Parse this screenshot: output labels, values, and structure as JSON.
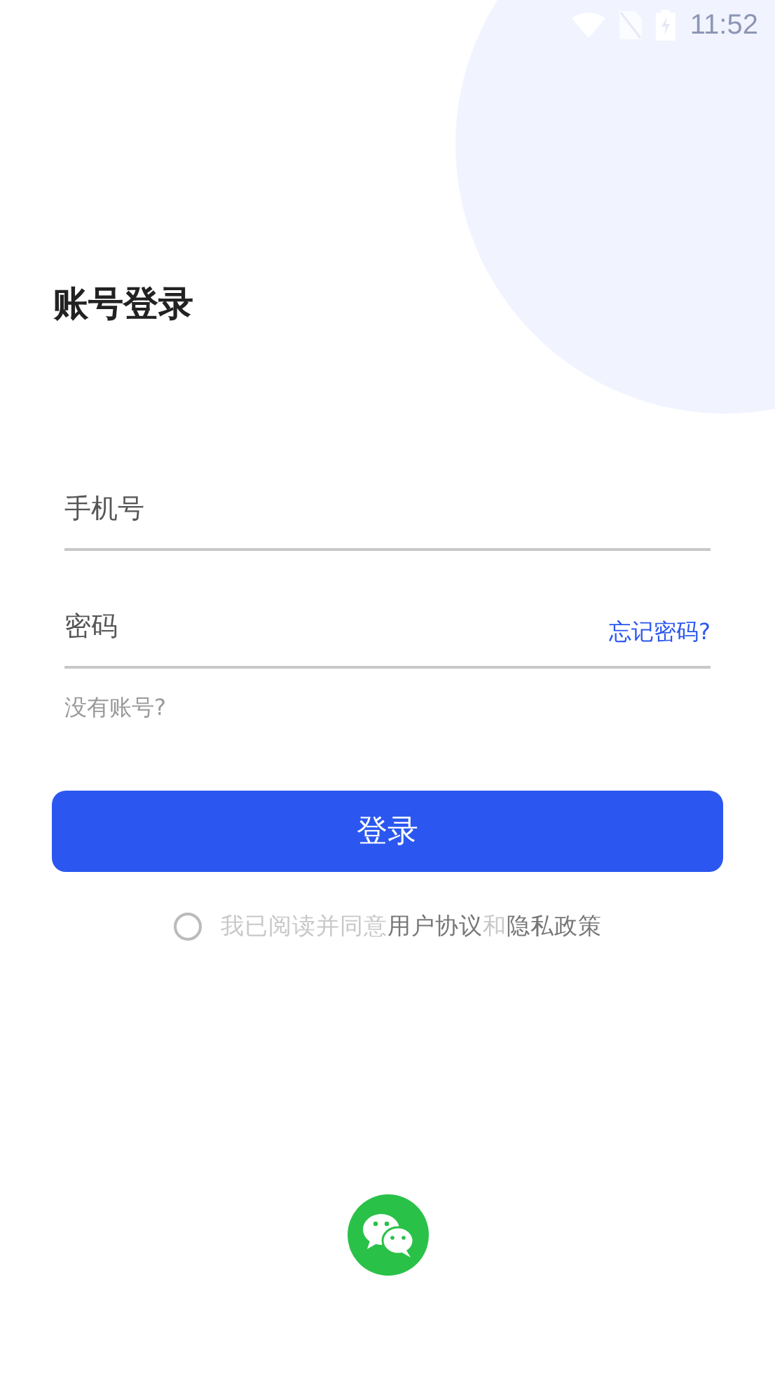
{
  "status_bar": {
    "time": "11:52"
  },
  "title": "账号登录",
  "fields": [
    {
      "placeholder": "手机号"
    },
    {
      "placeholder": "密码",
      "link": "忘记密码?"
    }
  ],
  "register_link": "没有账号?",
  "login_button": "登录",
  "agreement": {
    "checked": false,
    "parts": [
      {
        "kind": "text",
        "text": "我已阅读并同意"
      },
      {
        "kind": "link",
        "text": "用户协议"
      },
      {
        "kind": "text",
        "text": "和"
      },
      {
        "kind": "link",
        "text": "隐私政策"
      }
    ]
  }
}
